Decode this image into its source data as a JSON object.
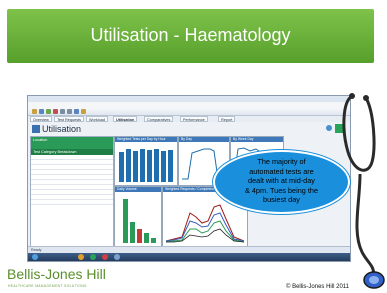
{
  "header": {
    "title": "Utilisation - Haematology"
  },
  "screenshot": {
    "app_title": "Utilisation",
    "tabs": [
      "Overview",
      "Test Requests",
      "Workload",
      "Utilisation",
      "Comparatives",
      "Performance",
      "Report"
    ],
    "active_tab": "Utilisation",
    "left_panel": {
      "header": "Location",
      "subheader": "Test Category Breakdown"
    },
    "chart_panels": [
      "Weighted Tests per Day by Hour",
      "By Day",
      "By Week Day",
      "Daily Volume",
      "Weighted Requests / Completed by Hour"
    ],
    "status_left": "Ready"
  },
  "callout": {
    "lines": [
      "The majority of",
      "automated tests are",
      "dealt with at mid-day",
      "& 4pm. Tues being the",
      "busiest day"
    ]
  },
  "footer": {
    "logo": "Bellis-Jones Hill",
    "logo_sub": "HEALTHCARE MANAGEMENT SOLUTIONS",
    "copyright": "© Bellis-Jones Hill 2011"
  },
  "colors": {
    "header_green": "#6cb33f",
    "callout_blue": "#1a8fdc",
    "logo_green": "#5a8f2c",
    "bar_blue": "#1f6fb0"
  }
}
